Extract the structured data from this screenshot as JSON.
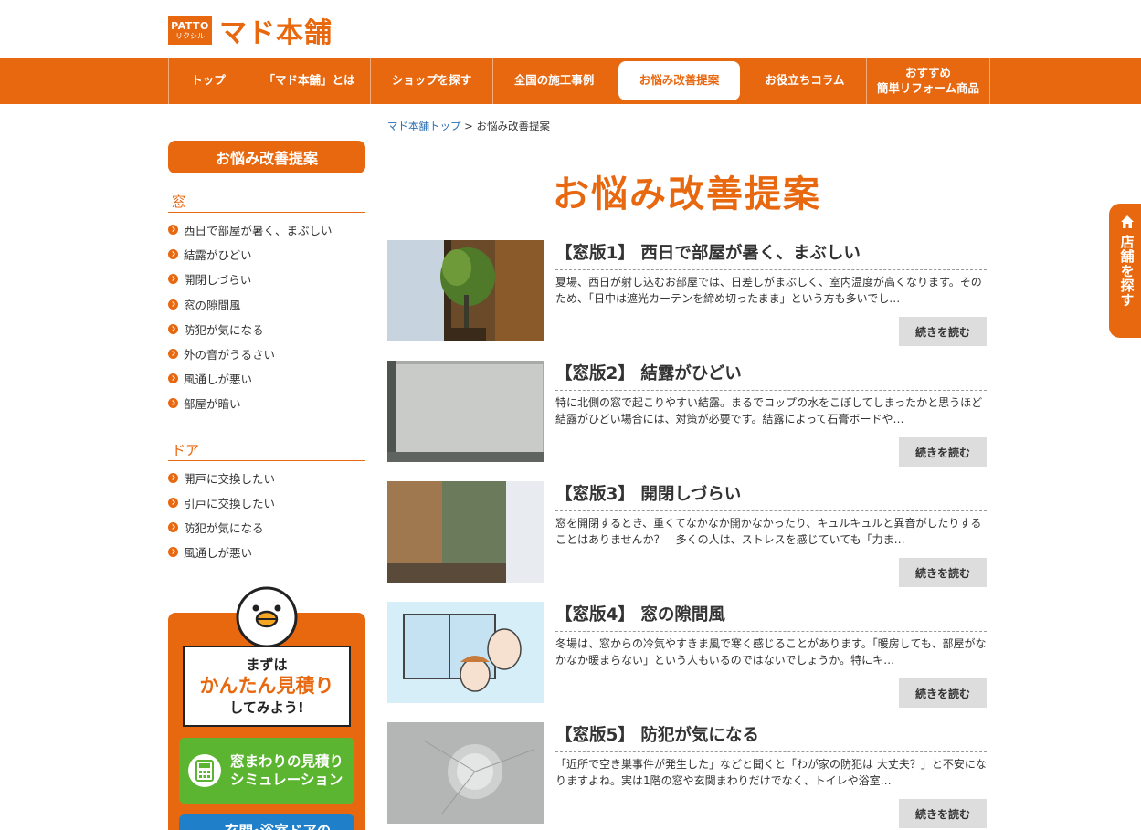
{
  "header": {
    "logo_badge_top": "PATTO",
    "logo_badge_bottom": "リクシル",
    "logo_text": "マド本舗"
  },
  "nav": {
    "items": [
      {
        "label": "トップ"
      },
      {
        "label": "「マド本舗」とは"
      },
      {
        "label": "ショップを探す"
      },
      {
        "label": "全国の施工事例"
      },
      {
        "label": "お悩み改善提案",
        "active": true
      },
      {
        "label": "お役立ちコラム"
      },
      {
        "label": "おすすめ\n簡単リフォーム商品"
      }
    ]
  },
  "side_tab": {
    "label": "店舗を探す",
    "icon": "home-icon"
  },
  "breadcrumb": {
    "home": "マド本舗トップ",
    "separator": ">",
    "current": "お悩み改善提案"
  },
  "page_title": "お悩み改善提案",
  "sidebar": {
    "heading": "お悩み改善提案",
    "categories": [
      {
        "title": "窓",
        "items": [
          "西日で部屋が暑く、まぶしい",
          "結露がひどい",
          "開閉しづらい",
          "窓の隙間風",
          "防犯が気になる",
          "外の音がうるさい",
          "風通しが悪い",
          "部屋が暗い"
        ]
      },
      {
        "title": "ドア",
        "items": [
          "開戸に交換したい",
          "引戸に交換したい",
          "防犯が気になる",
          "風通しが悪い"
        ]
      }
    ],
    "banner": {
      "line1": "まずは",
      "line2": "かんたん見積り",
      "line3": "してみよう!",
      "sim_button_line1": "窓まわりの見積り",
      "sim_button_line2": "シミュレーション",
      "door_button": "玄関･浴室ドアの"
    }
  },
  "articles": [
    {
      "title": "【窓版1】 西日で部屋が暑く、まぶしい",
      "text": "夏場、西日が射し込むお部屋では、日差しがまぶしく、室内温度が高くなります。そのため、「日中は遮光カーテンを締め切ったまま」という方も多いでし…",
      "more": "続きを読む"
    },
    {
      "title": "【窓版2】 結露がひどい",
      "text": "特に北側の窓で起こりやすい結露。まるでコップの水をこぼしてしまったかと思うほど結露がひどい場合には、対策が必要です。結露によって石膏ボードや…",
      "more": "続きを読む"
    },
    {
      "title": "【窓版3】 開閉しづらい",
      "text": "窓を開閉するとき、重くてなかなか開かなかったり、キュルキュルと異音がしたりすることはありませんか？　多くの人は、ストレスを感じていても「力ま…",
      "more": "続きを読む"
    },
    {
      "title": "【窓版4】 窓の隙間風",
      "text": "冬場は、窓からの冷気やすきま風で寒く感じることがあります。「暖房しても、部屋がなかなか暖まらない」という人もいるのではないでしょうか。特にキ…",
      "more": "続きを読む"
    },
    {
      "title": "【窓版5】 防犯が気になる",
      "text": "「近所で空き巣事件が発生した」などと聞くと「わが家の防犯は 大丈夫？」と不安になりますよね。実は1階の窓や玄関まわりだけでなく、トイレや浴室…",
      "more": "続きを読む"
    }
  ],
  "colors": {
    "accent": "#e8680f",
    "green": "#5cb531",
    "blue": "#1f7fc8",
    "button_gray": "#dddddd"
  }
}
